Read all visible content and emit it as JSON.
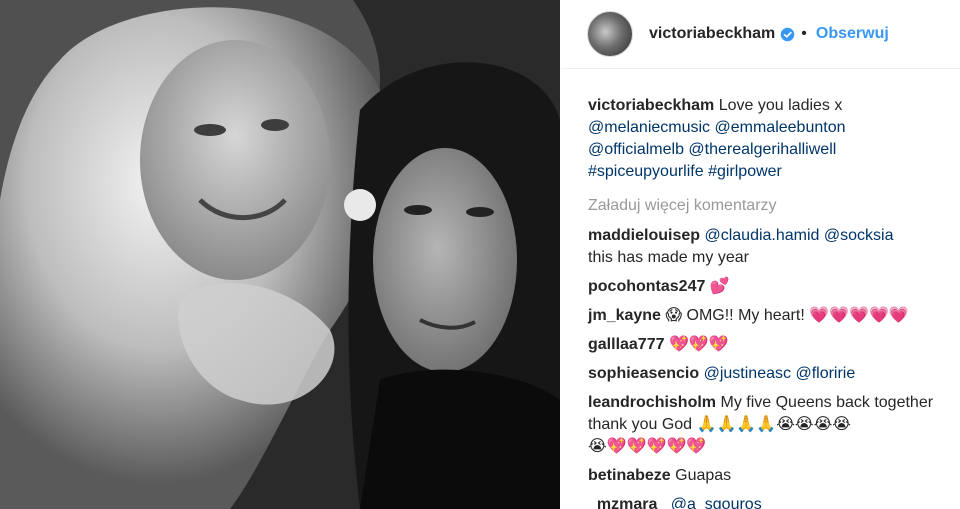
{
  "post": {
    "username": "victoriabeckham",
    "dot": "•",
    "follow_label": "Obserwuj",
    "verified_icon": "verified-badge-icon",
    "accent": "#3897f0"
  },
  "caption": {
    "user": "victoriabeckham",
    "text": "Love you ladies x",
    "line2": "@melaniecmusic @emmaleebunton",
    "line3": "@officialmelb @therealgerihalliwell",
    "line4": "#spiceupyourlife #girlpower"
  },
  "load_more": "Załaduj więcej komentarzy",
  "comments": [
    {
      "user": "maddielouisep",
      "mentions": "@claudia.hamid @socksia",
      "text": "this has made my year"
    },
    {
      "user": "pocohontas247",
      "text": "💕"
    },
    {
      "user": "jm_kayne",
      "text": "😱 OMG!! My heart! 💗💗💗💗💗"
    },
    {
      "user": "galllaa777",
      "text": "💖💖💖"
    },
    {
      "user": "sophieasencio",
      "mentions": "@justineasc @floririe"
    },
    {
      "user": "leandrochisholm",
      "text": "My five Queens back together thank you God 🙏🙏🙏🙏😭😭😭😭",
      "text2": "😭💖💖💖💖💖"
    },
    {
      "user": "betinabeze",
      "text": "Guapas"
    },
    {
      "user": "_mzmara_",
      "mentions": "@a_sgouros"
    }
  ]
}
